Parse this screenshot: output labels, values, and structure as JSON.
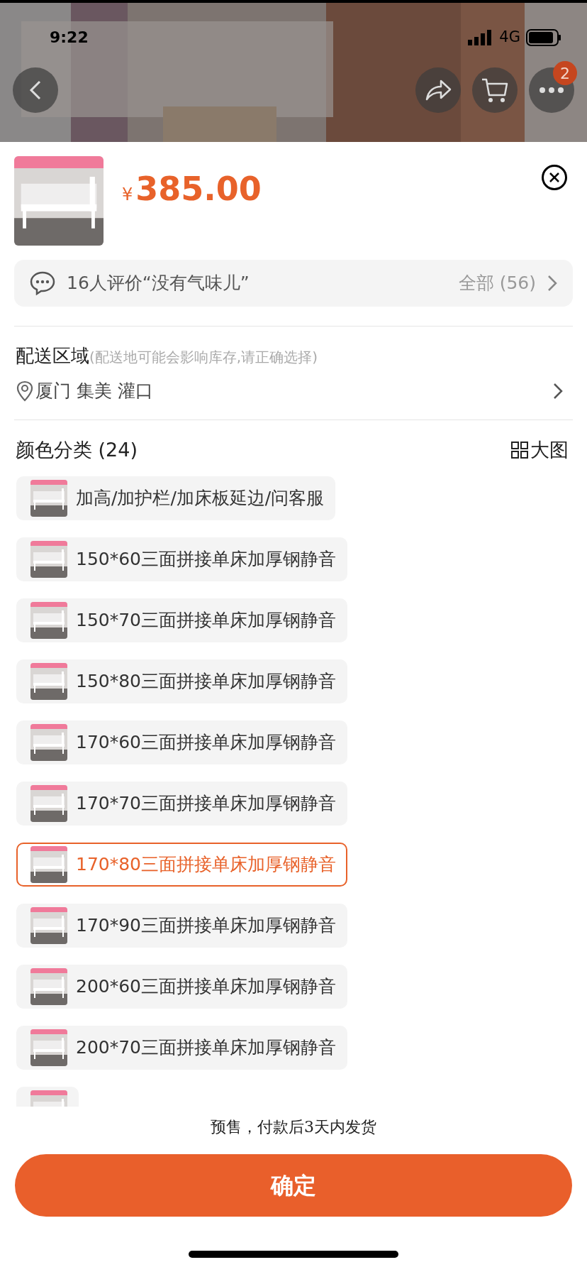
{
  "status_bar": {
    "time": "9:22",
    "network": "4G"
  },
  "header": {
    "cart_badge": "2"
  },
  "product": {
    "currency": "¥",
    "price": "385.00"
  },
  "reviews": {
    "summary": "16人评价“没有气味儿”",
    "all": "全部 (56)"
  },
  "delivery": {
    "title": "配送区域",
    "hint": "(配送地可能会影响库存,请正确选择)",
    "location": "厦门 集美 灌口"
  },
  "colors": {
    "title": "颜色分类 (24)",
    "large_view": "大图",
    "options": [
      {
        "label": "加高/加护栏/加床板延边/问客服",
        "selected": false
      },
      {
        "label": "150*60三面拼接单床加厚钢静音",
        "selected": false
      },
      {
        "label": "150*70三面拼接单床加厚钢静音",
        "selected": false
      },
      {
        "label": "150*80三面拼接单床加厚钢静音",
        "selected": false
      },
      {
        "label": "170*60三面拼接单床加厚钢静音",
        "selected": false
      },
      {
        "label": "170*70三面拼接单床加厚钢静音",
        "selected": false
      },
      {
        "label": "170*80三面拼接单床加厚钢静音",
        "selected": true
      },
      {
        "label": "170*90三面拼接单床加厚钢静音",
        "selected": false
      },
      {
        "label": "200*60三面拼接单床加厚钢静音",
        "selected": false
      },
      {
        "label": "200*70三面拼接单床加厚钢静音",
        "selected": false
      },
      {
        "selected": false
      }
    ]
  },
  "footer": {
    "note": "预售，付款后3天内发货",
    "confirm": "确定"
  }
}
